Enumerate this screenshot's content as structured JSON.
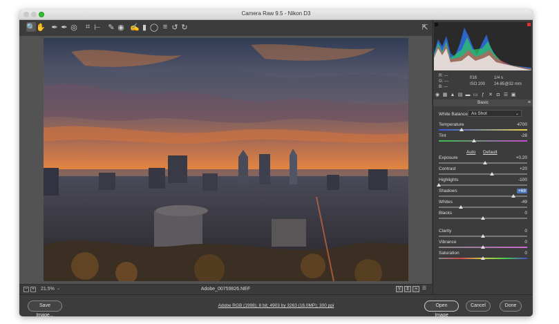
{
  "window": {
    "title": "Camera Raw 9.5  -  Nikon D3"
  },
  "toolbar": {
    "tools": [
      {
        "name": "zoom-tool-icon",
        "glyph": "🔍"
      },
      {
        "name": "hand-tool-icon",
        "glyph": "✋"
      },
      {
        "name": "white-balance-tool-icon",
        "glyph": "✒"
      },
      {
        "name": "color-sampler-tool-icon",
        "glyph": "✒"
      },
      {
        "name": "targeted-adjustment-tool-icon",
        "glyph": "◎"
      },
      {
        "name": "crop-tool-icon",
        "glyph": "⌗"
      },
      {
        "name": "straighten-tool-icon",
        "glyph": "⊢"
      },
      {
        "name": "spot-removal-tool-icon",
        "glyph": "✎"
      },
      {
        "name": "red-eye-tool-icon",
        "glyph": "◉"
      },
      {
        "name": "adjustment-brush-icon",
        "glyph": "✍"
      },
      {
        "name": "graduated-filter-icon",
        "glyph": "▮"
      },
      {
        "name": "radial-filter-icon",
        "glyph": "◯"
      },
      {
        "name": "preferences-icon",
        "glyph": "≡"
      },
      {
        "name": "rotate-ccw-icon",
        "glyph": "↺"
      },
      {
        "name": "rotate-cw-icon",
        "glyph": "↻"
      }
    ],
    "fullscreen_icon": "⇱"
  },
  "status": {
    "zoom_minus": "−",
    "zoom_plus": "+",
    "zoom_level": "21.5%",
    "filename": "Adobe_00759826.NEF",
    "icon_y": "Y",
    "icon_compare": "⇕",
    "icon_plus": "+",
    "icon_settings": "☰"
  },
  "bottom": {
    "save": "Save Image...",
    "workflow": "Adobe RGB (1998); 8 bit; 4903 by 3263 (16.0MP); 300 ppi",
    "open": "Open Image",
    "cancel": "Cancel",
    "done": "Done"
  },
  "info": {
    "r": "R:",
    "g": "G:",
    "b": "B:",
    "dash": "---",
    "aperture": "f/16",
    "shutter": "1/4 s",
    "iso": "ISO 200",
    "lens": "24-85@32 mm"
  },
  "panel": {
    "section": "Basic",
    "wb_label": "White Balance:",
    "wb_value": "As Shot",
    "auto": "Auto",
    "default": "Default",
    "sliders": [
      {
        "id": "temperature",
        "label": "Temperature",
        "value": "4700",
        "pos": 0.26
      },
      {
        "id": "tint",
        "label": "Tint",
        "value": "-28",
        "pos": 0.4
      },
      {
        "id": "exposure",
        "label": "Exposure",
        "value": "+0.20",
        "pos": 0.52
      },
      {
        "id": "contrast",
        "label": "Contrast",
        "value": "+20",
        "pos": 0.6
      },
      {
        "id": "highlights",
        "label": "Highlights",
        "value": "-100",
        "pos": 0.0
      },
      {
        "id": "shadows",
        "label": "Shadows",
        "value": "+68",
        "pos": 0.84,
        "highlight": true
      },
      {
        "id": "whites",
        "label": "Whites",
        "value": "-49",
        "pos": 0.25
      },
      {
        "id": "blacks",
        "label": "Blacks",
        "value": "0",
        "pos": 0.5
      },
      {
        "id": "clarity",
        "label": "Clarity",
        "value": "0",
        "pos": 0.5
      },
      {
        "id": "vibrance",
        "label": "Vibrance",
        "value": "0",
        "pos": 0.5
      },
      {
        "id": "saturation",
        "label": "Saturation",
        "value": "0",
        "pos": 0.5
      }
    ]
  }
}
